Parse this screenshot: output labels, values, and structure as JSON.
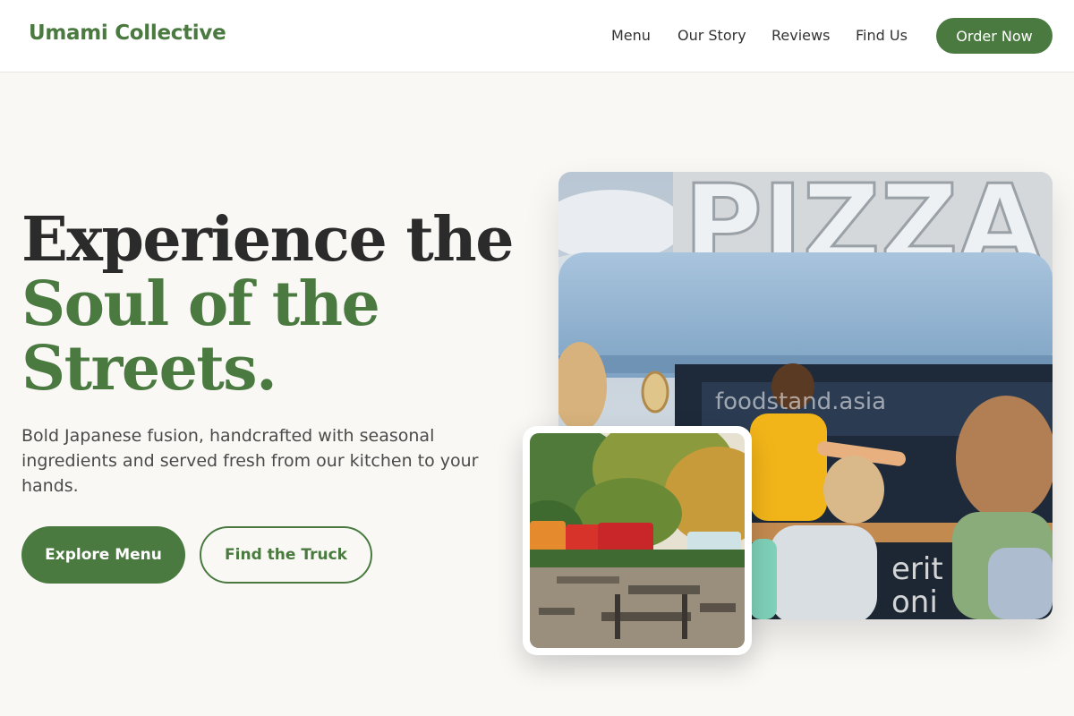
{
  "header": {
    "logo": "Umami Collective",
    "nav": [
      "Menu",
      "Our Story",
      "Reviews",
      "Find Us"
    ],
    "cta": "Order Now"
  },
  "hero": {
    "headline_line1": "Experience the",
    "headline_line2": "Soul of the",
    "headline_line3": "Streets.",
    "subtext": "Bold Japanese fusion, handcrafted with seasonal ingredients and served fresh from our kitchen to your hands.",
    "primary_button": "Explore Menu",
    "secondary_button": "Find the Truck"
  },
  "images": {
    "main_sign_text": "PIZZA",
    "main_watermark": "foodstand.asia",
    "main_alt": "food-truck-photo",
    "inset_alt": "food-truck-park-photo"
  },
  "colors": {
    "brand_green": "#4a7a40",
    "background": "#f9f8f5",
    "text_dark": "#2b2b2b"
  }
}
